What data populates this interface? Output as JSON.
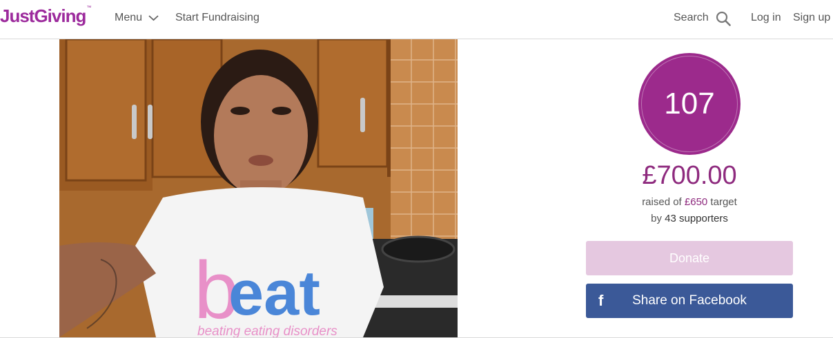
{
  "header": {
    "logo_text": "JustGiving",
    "logo_tm": "™",
    "menu_label": "Menu",
    "start_label": "Start Fundraising",
    "search_label": "Search",
    "login_label": "Log in",
    "signup_label": "Sign up"
  },
  "photo": {
    "shirt_text_b": "b",
    "shirt_text_eat": "eat",
    "shirt_tagline": "beating eating disorders"
  },
  "stats": {
    "supporters_badge": "107",
    "amount_raised": "£700.00",
    "raised_prefix": "raised of ",
    "target_amount": "£650",
    "raised_suffix": " target",
    "by_prefix": "by ",
    "supporters_text": "43 supporters"
  },
  "actions": {
    "donate_label": "Donate",
    "facebook_label": "Share on Facebook",
    "facebook_icon": "f"
  },
  "colors": {
    "brand_purple": "#9c2a8c",
    "donate_disabled": "#e5c8e0",
    "facebook_blue": "#3b5998"
  }
}
